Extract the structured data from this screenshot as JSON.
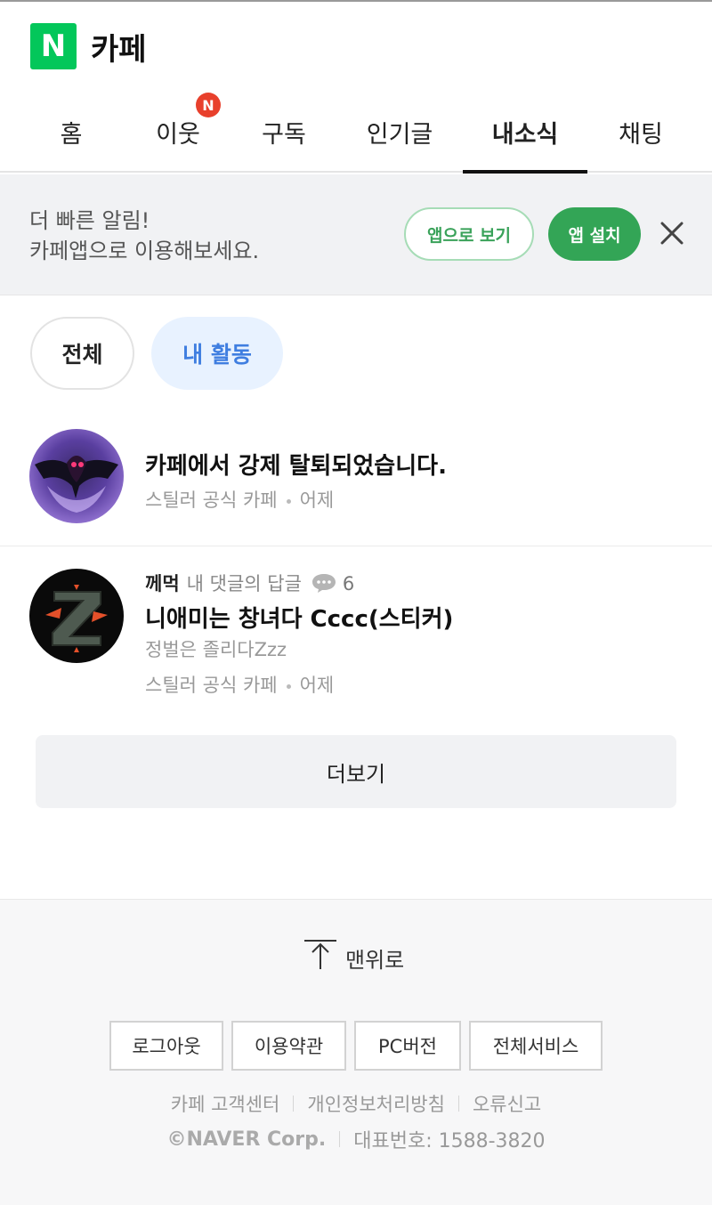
{
  "header": {
    "logo_letter": "N",
    "title": "카페"
  },
  "tabs": [
    {
      "label": "홈"
    },
    {
      "label": "이웃",
      "badge": "N"
    },
    {
      "label": "구독"
    },
    {
      "label": "인기글"
    },
    {
      "label": "내소식",
      "active": true
    },
    {
      "label": "채팅"
    }
  ],
  "banner": {
    "line1": "더 빠른 알림!",
    "line2": "카페앱으로 이용해보세요.",
    "open_app_label": "앱으로 보기",
    "install_label": "앱 설치",
    "close_icon": "close-icon"
  },
  "filters": {
    "all_label": "전체",
    "mine_label": "내 활동",
    "selected": "내 활동"
  },
  "feed": [
    {
      "title": "카페에서 강제 탈퇴되었습니다.",
      "cafe": "스틸러 공식 카페",
      "time": "어제"
    },
    {
      "author": "께먹",
      "type": "내 댓글의 답글",
      "comment_count": "6",
      "title": "니애미는 창녀다 Cccc(스티커)",
      "snippet": "정벌은 졸리다Zzz",
      "cafe": "스틸러 공식 카페",
      "time": "어제"
    }
  ],
  "more_label": "더보기",
  "footer": {
    "to_top_label": "맨위로",
    "buttons": [
      "로그아웃",
      "이용약관",
      "PC버전",
      "전체서비스"
    ],
    "links": [
      "카페 고객센터",
      "개인정보처리방침",
      "오류신고"
    ],
    "copyright": "©NAVER Corp.",
    "phone": "대표번호: 1588-3820"
  },
  "colors": {
    "brand_green": "#03c75a",
    "install_green": "#33a556",
    "chip_blue": "#3f7ee0",
    "badge_red": "#e8402c"
  }
}
